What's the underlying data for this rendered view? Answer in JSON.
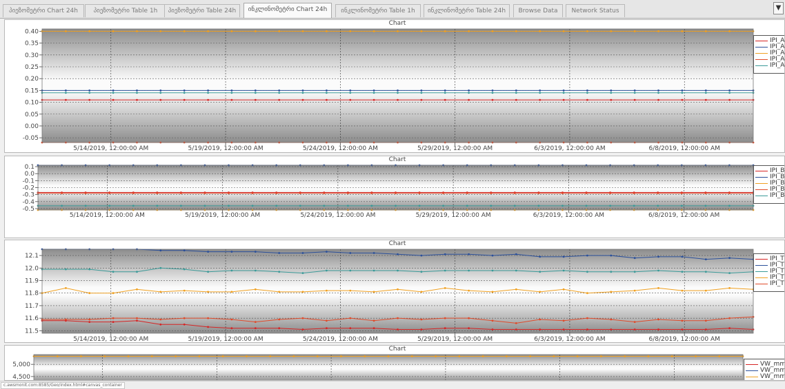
{
  "tabs": [
    {
      "label": "პიეზომეტრი Chart 24h",
      "active": false
    },
    {
      "label": "პიეზომეტრი Table 1h",
      "active": false
    },
    {
      "label": "პიეზომეტრი Table 24h",
      "active": false
    },
    {
      "label": "ინკლინომეტრი Chart 24h",
      "active": true
    },
    {
      "label": "ინკლინომეტრი Table 1h",
      "active": false
    },
    {
      "label": "ინკლინომეტრი Table 24h",
      "active": false
    },
    {
      "label": "Browse Data",
      "active": false
    },
    {
      "label": "Network Status",
      "active": false
    }
  ],
  "tab_scroll_icon": "dropdown-arrow-icon",
  "tab_scroll_glyph": "▼",
  "status_url": "c.awsmonit.com:8585/Geo/index.html#canvas_container",
  "x_tick_labels": [
    "5/14/2019, 12:00:00 AM",
    "5/19/2019, 12:00:00 AM",
    "5/24/2019, 12:00:00 AM",
    "5/29/2019, 12:00:00 AM",
    "6/3/2019, 12:00:00 AM",
    "6/8/2019, 12:00:00 AM"
  ],
  "chart_data": [
    {
      "type": "line",
      "title": "Chart",
      "xlabel": "",
      "ylabel": "",
      "grid": true,
      "legend_position": "right",
      "x_start": "5/11/2019",
      "x_end": "6/11/2019",
      "x_ticks": [
        "5/14/2019",
        "5/19/2019",
        "5/24/2019",
        "5/29/2019",
        "6/3/2019",
        "6/8/2019"
      ],
      "yticks": [
        "0.40",
        "0.35",
        "0.30",
        "0.25",
        "0.20",
        "0.15",
        "0.10",
        "0.05",
        "0.00",
        "-0.05"
      ],
      "ylim": [
        -0.07,
        0.41
      ],
      "series": [
        {
          "name": "IPI_A(",
          "color": "#d62424",
          "values": [
            0.11,
            0.11,
            0.11,
            0.11,
            0.11,
            0.11,
            0.11,
            0.11,
            0.11,
            0.11,
            0.11,
            0.11,
            0.11,
            0.11,
            0.11,
            0.11,
            0.11,
            0.11,
            0.11,
            0.11,
            0.11,
            0.11,
            0.11,
            0.11,
            0.11,
            0.11,
            0.11,
            0.11,
            0.11,
            0.11,
            0.11
          ]
        },
        {
          "name": "IPI_A(",
          "color": "#2a4f9a",
          "values": [
            0.15,
            0.15,
            0.15,
            0.15,
            0.15,
            0.15,
            0.15,
            0.15,
            0.15,
            0.15,
            0.15,
            0.15,
            0.15,
            0.15,
            0.15,
            0.15,
            0.15,
            0.15,
            0.15,
            0.15,
            0.15,
            0.15,
            0.15,
            0.15,
            0.15,
            0.15,
            0.15,
            0.15,
            0.15,
            0.15,
            0.15
          ]
        },
        {
          "name": "IPI_A(",
          "color": "#f0a020",
          "values": [
            0.4,
            0.4,
            0.4,
            0.4,
            0.4,
            0.4,
            0.4,
            0.4,
            0.4,
            0.4,
            0.4,
            0.4,
            0.4,
            0.4,
            0.4,
            0.4,
            0.4,
            0.4,
            0.4,
            0.4,
            0.4,
            0.4,
            0.4,
            0.4,
            0.4,
            0.4,
            0.4,
            0.4,
            0.4,
            0.4,
            0.4
          ]
        },
        {
          "name": "IPI_A(",
          "color": "#e04a2a",
          "values": [
            -0.07,
            -0.07,
            -0.07,
            -0.07,
            -0.07,
            -0.07,
            -0.07,
            -0.07,
            -0.07,
            -0.07,
            -0.07,
            -0.07,
            -0.07,
            -0.07,
            -0.07,
            -0.07,
            -0.07,
            -0.07,
            -0.07,
            -0.07,
            -0.07,
            -0.07,
            -0.07,
            -0.07,
            -0.07,
            -0.07,
            -0.07,
            -0.07,
            -0.07,
            -0.07,
            -0.07
          ]
        },
        {
          "name": "IPI_A(",
          "color": "#3a9a98",
          "values": [
            0.14,
            0.14,
            0.14,
            0.14,
            0.14,
            0.14,
            0.14,
            0.14,
            0.14,
            0.14,
            0.14,
            0.14,
            0.14,
            0.14,
            0.14,
            0.14,
            0.14,
            0.14,
            0.14,
            0.14,
            0.14,
            0.14,
            0.14,
            0.14,
            0.14,
            0.14,
            0.14,
            0.14,
            0.14,
            0.14,
            0.14
          ]
        }
      ]
    },
    {
      "type": "line",
      "title": "Chart",
      "xlabel": "",
      "ylabel": "",
      "grid": true,
      "legend_position": "right",
      "x_start": "5/11/2019",
      "x_end": "6/11/2019",
      "x_ticks": [
        "5/14/2019",
        "5/19/2019",
        "5/24/2019",
        "5/29/2019",
        "6/3/2019",
        "6/8/2019"
      ],
      "yticks": [
        "0.1",
        "0.0",
        "-0.1",
        "-0.2",
        "-0.3",
        "-0.4",
        "-0.5"
      ],
      "ylim": [
        -0.52,
        0.12
      ],
      "series": [
        {
          "name": "IPI_B(",
          "color": "#d62424",
          "values": [
            -0.27,
            -0.27,
            -0.27,
            -0.27,
            -0.27,
            -0.27,
            -0.27,
            -0.27,
            -0.27,
            -0.27,
            -0.27,
            -0.27,
            -0.27,
            -0.27,
            -0.27,
            -0.27,
            -0.27,
            -0.27,
            -0.27,
            -0.27,
            -0.27,
            -0.27,
            -0.27,
            -0.27,
            -0.27,
            -0.27,
            -0.27,
            -0.27,
            -0.27,
            -0.27,
            -0.27
          ]
        },
        {
          "name": "IPI_B(",
          "color": "#2a4f9a",
          "values": [
            0.12,
            0.12,
            0.12,
            0.12,
            0.12,
            0.12,
            0.12,
            0.12,
            0.12,
            0.12,
            0.12,
            0.12,
            0.12,
            0.12,
            0.12,
            0.12,
            0.12,
            0.12,
            0.12,
            0.12,
            0.12,
            0.12,
            0.12,
            0.12,
            0.12,
            0.12,
            0.12,
            0.12,
            0.12,
            0.12,
            0.12
          ]
        },
        {
          "name": "IPI_B(",
          "color": "#f0a020",
          "values": [
            -0.52,
            -0.52,
            -0.52,
            -0.52,
            -0.52,
            -0.52,
            -0.52,
            -0.52,
            -0.52,
            -0.52,
            -0.52,
            -0.52,
            -0.52,
            -0.52,
            -0.52,
            -0.52,
            -0.52,
            -0.52,
            -0.52,
            -0.52,
            -0.52,
            -0.52,
            -0.52,
            -0.52,
            -0.52,
            -0.52,
            -0.52,
            -0.52,
            -0.52,
            -0.52,
            -0.52
          ]
        },
        {
          "name": "IPI_B(",
          "color": "#e04a2a",
          "values": [
            -0.28,
            -0.28,
            -0.28,
            -0.28,
            -0.28,
            -0.28,
            -0.28,
            -0.28,
            -0.28,
            -0.28,
            -0.28,
            -0.28,
            -0.28,
            -0.28,
            -0.28,
            -0.28,
            -0.28,
            -0.28,
            -0.28,
            -0.28,
            -0.28,
            -0.28,
            -0.28,
            -0.28,
            -0.28,
            -0.28,
            -0.28,
            -0.28,
            -0.28,
            -0.28,
            -0.28
          ]
        },
        {
          "name": "IPI_B(",
          "color": "#3a9a98",
          "values": [
            -0.46,
            -0.46,
            -0.46,
            -0.46,
            -0.46,
            -0.46,
            -0.46,
            -0.46,
            -0.46,
            -0.46,
            -0.46,
            -0.46,
            -0.46,
            -0.46,
            -0.46,
            -0.46,
            -0.46,
            -0.46,
            -0.46,
            -0.46,
            -0.46,
            -0.46,
            -0.46,
            -0.46,
            -0.46,
            -0.46,
            -0.46,
            -0.46,
            -0.46,
            -0.46,
            -0.46
          ]
        }
      ]
    },
    {
      "type": "line",
      "title": "Chart",
      "xlabel": "",
      "ylabel": "",
      "grid": true,
      "legend_position": "right",
      "x_start": "5/11/2019",
      "x_end": "6/11/2019",
      "x_ticks": [
        "5/14/2019",
        "5/19/2019",
        "5/24/2019",
        "5/29/2019",
        "6/3/2019",
        "6/8/2019"
      ],
      "yticks": [
        "12.1",
        "12.0",
        "11.9",
        "11.8",
        "11.7",
        "11.6",
        "11.5"
      ],
      "ylim": [
        11.48,
        12.15
      ],
      "series": [
        {
          "name": "IPI_T(",
          "color": "#d62424",
          "values": [
            11.58,
            11.58,
            11.57,
            11.57,
            11.58,
            11.55,
            11.55,
            11.53,
            11.52,
            11.52,
            11.52,
            11.51,
            11.52,
            11.52,
            11.52,
            11.51,
            11.51,
            11.52,
            11.52,
            11.51,
            11.51,
            11.51,
            11.51,
            11.51,
            11.51,
            11.51,
            11.51,
            11.51,
            11.51,
            11.52,
            11.51
          ]
        },
        {
          "name": "IPI_T(",
          "color": "#2a4f9a",
          "values": [
            12.15,
            12.15,
            12.15,
            12.15,
            12.15,
            12.14,
            12.14,
            12.13,
            12.13,
            12.13,
            12.12,
            12.12,
            12.13,
            12.12,
            12.12,
            12.11,
            12.1,
            12.11,
            12.11,
            12.1,
            12.11,
            12.09,
            12.09,
            12.1,
            12.1,
            12.08,
            12.09,
            12.09,
            12.07,
            12.08,
            12.07
          ]
        },
        {
          "name": "IPI_T(",
          "color": "#3a9a98",
          "values": [
            11.99,
            11.99,
            11.99,
            11.97,
            11.97,
            12.0,
            11.99,
            11.97,
            11.98,
            11.98,
            11.97,
            11.96,
            11.98,
            11.98,
            11.98,
            11.98,
            11.97,
            11.98,
            11.98,
            11.98,
            11.98,
            11.97,
            11.98,
            11.97,
            11.97,
            11.97,
            11.98,
            11.97,
            11.97,
            11.96,
            11.97
          ]
        },
        {
          "name": "IPI_T(",
          "color": "#f0a020",
          "values": [
            11.8,
            11.84,
            11.8,
            11.8,
            11.83,
            11.81,
            11.82,
            11.81,
            11.81,
            11.83,
            11.81,
            11.81,
            11.82,
            11.82,
            11.81,
            11.83,
            11.81,
            11.84,
            11.82,
            11.81,
            11.83,
            11.81,
            11.83,
            11.8,
            11.81,
            11.82,
            11.84,
            11.82,
            11.82,
            11.84,
            11.83
          ]
        },
        {
          "name": "IPI_T(",
          "color": "#e04a2a",
          "values": [
            11.59,
            11.59,
            11.59,
            11.6,
            11.6,
            11.59,
            11.6,
            11.6,
            11.59,
            11.57,
            11.59,
            11.6,
            11.58,
            11.6,
            11.58,
            11.6,
            11.59,
            11.6,
            11.6,
            11.58,
            11.56,
            11.59,
            11.58,
            11.6,
            11.59,
            11.57,
            11.59,
            11.58,
            11.58,
            11.6,
            11.61
          ]
        }
      ]
    },
    {
      "type": "line",
      "title": "Chart",
      "xlabel": "",
      "ylabel": "",
      "grid": true,
      "legend_position": "right",
      "x_start": "5/11/2019",
      "x_end": "6/11/2019",
      "yticks": [
        "5,000",
        "4,500"
      ],
      "ylim": [
        4300,
        5400
      ],
      "series": [
        {
          "name": "VW_mm(",
          "color": "#d62424",
          "values": []
        },
        {
          "name": "VW_mm(",
          "color": "#2a4f9a",
          "values": []
        },
        {
          "name": "VW_mm(",
          "color": "#f0a020",
          "values": [
            5330,
            5330,
            5330,
            5330,
            5330,
            5330,
            5330,
            5330,
            5330,
            5330,
            5330,
            5330,
            5330,
            5330,
            5330,
            5330,
            5330,
            5330,
            5330,
            5330,
            5330,
            5330,
            5330,
            5330,
            5330,
            5330,
            5330,
            5330,
            5330,
            5330,
            5330
          ]
        }
      ]
    }
  ]
}
